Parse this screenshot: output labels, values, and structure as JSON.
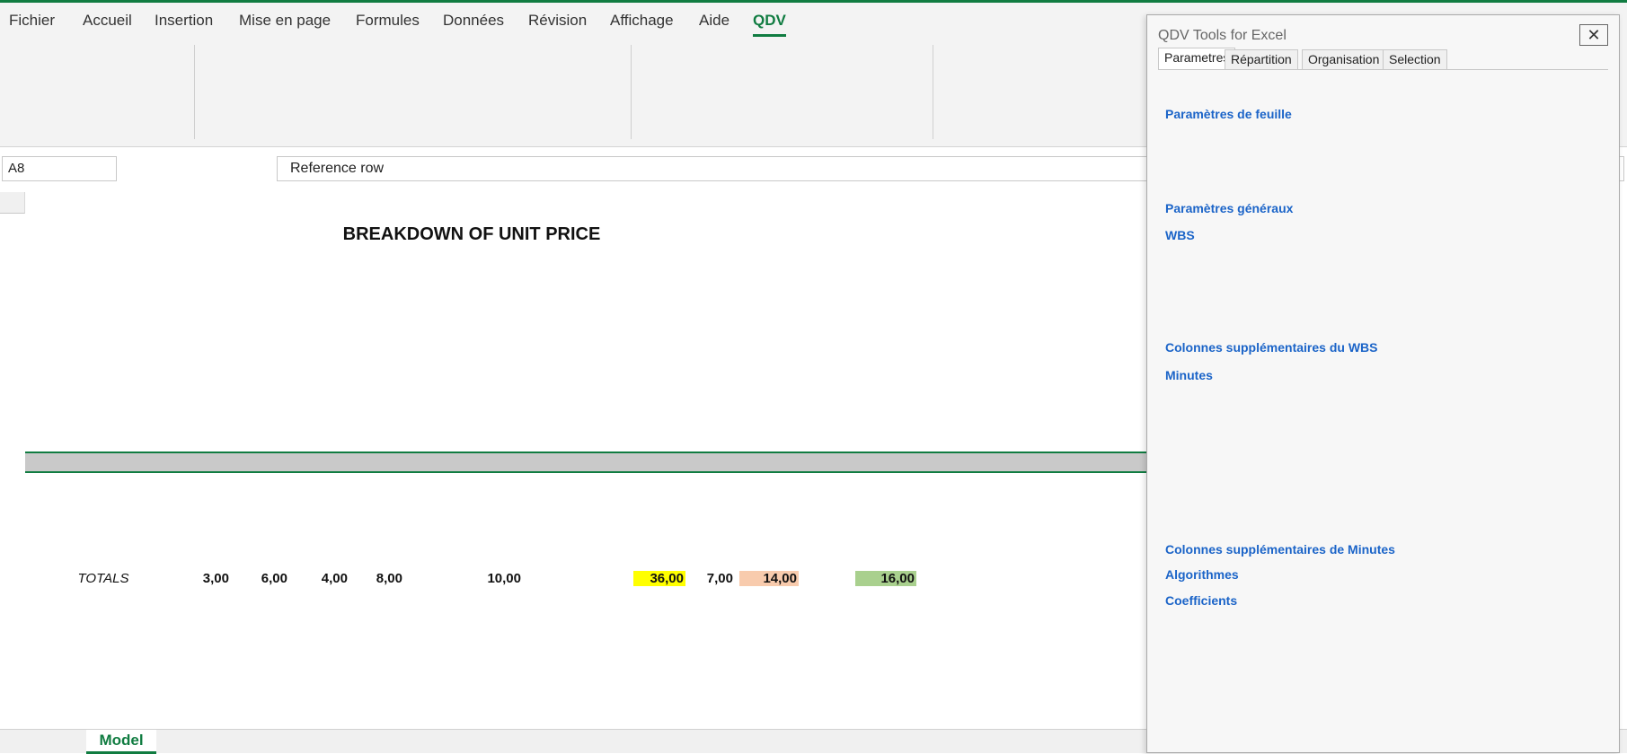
{
  "ribbon": {
    "tabs": [
      "Fichier",
      "Accueil",
      "Insertion",
      "Mise en page",
      "Formules",
      "Données",
      "Révision",
      "Affichage",
      "Aide",
      "QDV"
    ]
  },
  "formula_bar": {
    "name_box": "A8",
    "formula": "Reference row"
  },
  "sheet": {
    "title": "BREAKDOWN OF UNIT PRICE",
    "totals": {
      "label": "TOTALS",
      "values": [
        "3,00",
        "6,00",
        "4,00",
        "8,00",
        "10,00",
        "36,00",
        "7,00",
        "14,00",
        "16,00"
      ]
    }
  },
  "sheet_tabs": [
    "Model"
  ],
  "panel": {
    "title": "QDV Tools for Excel",
    "tabs": [
      "Parametres",
      "Répartition",
      "Organisation",
      "Selection"
    ],
    "sections": [
      "Paramètres de feuille",
      "Paramètres généraux",
      "WBS",
      "Colonnes supplémentaires du WBS",
      "Minutes",
      "Colonnes supplémentaires de Minutes",
      "Algorithmes",
      "Coefficients"
    ]
  },
  "colors": {
    "accent": "#107c41",
    "panel_link": "#1b64c8"
  }
}
